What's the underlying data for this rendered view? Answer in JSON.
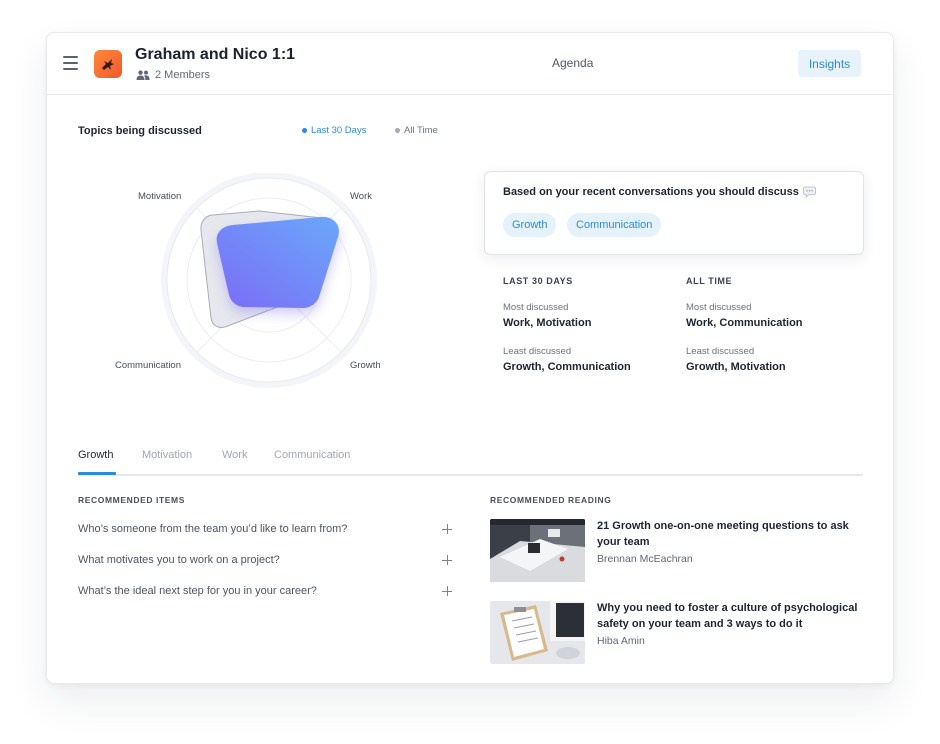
{
  "header": {
    "title": "Graham and Nico 1:1",
    "members": "2 Members",
    "agenda_tab": "Agenda",
    "insights_button": "Insights"
  },
  "topics": {
    "title": "Topics being discussed",
    "legend": [
      {
        "label": "Last 30 Days",
        "color": "#2d8bd6",
        "active": true
      },
      {
        "label": "All Time",
        "color": "#a6aab4",
        "active": false
      }
    ],
    "radar_axes": [
      "Motivation",
      "Work",
      "Communication",
      "Growth"
    ]
  },
  "suggestion": {
    "text": "Based on your recent conversations you should discuss",
    "chips": [
      "Growth",
      "Communication"
    ]
  },
  "stats": {
    "last30": {
      "heading": "LAST 30 DAYS",
      "most_label": "Most discussed",
      "most_value": "Work, Motivation",
      "least_label": "Least discussed",
      "least_value": "Growth, Communication"
    },
    "all_time": {
      "heading": "ALL TIME",
      "most_label": "Most discussed",
      "most_value": "Work, Communication",
      "least_label": "Least discussed",
      "least_value": "Growth, Motivation"
    }
  },
  "tabs": [
    "Growth",
    "Motivation",
    "Work",
    "Communication"
  ],
  "active_tab": "Growth",
  "recommended_items": {
    "heading": "RECOMMENDED ITEMS",
    "items": [
      "Who’s someone from the team you’d like to learn from?",
      "What motivates you to work on a project?",
      "What’s the ideal next step for you in your career?"
    ]
  },
  "recommended_reading": {
    "heading": "RECOMMENDED READING",
    "articles": [
      {
        "title": "21 Growth one-on-one meeting questions to ask your team",
        "author": "Brennan McEachran"
      },
      {
        "title": "Why you need to foster a culture of psychological safety on your team and 3 ways to do it",
        "author": "Hiba Amin"
      }
    ]
  },
  "colors": {
    "accent": "#2d8bd6",
    "radar_recent_start": "#7b6cf6",
    "radar_recent_end": "#6aa8fa",
    "brand_avatar": "#f2572b"
  }
}
